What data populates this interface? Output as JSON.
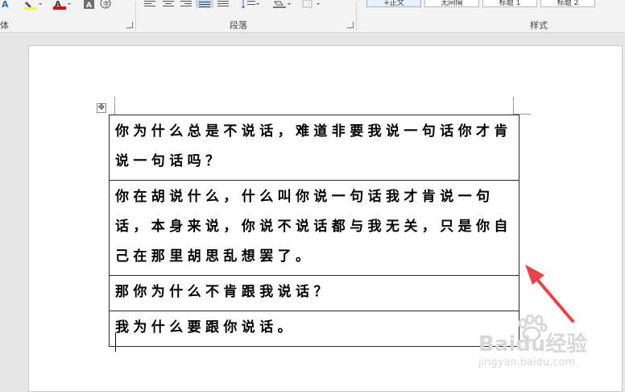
{
  "ribbon": {
    "font_group_label": "体",
    "paragraph_group_label": "段落",
    "styles_group_label": "样式",
    "styles": [
      "+正文",
      "无间隔",
      "标题 1",
      "标题 2"
    ]
  },
  "document": {
    "table_rows": [
      "你为什么总是不说话，难道非要我说一句话你才肯说一句话吗？",
      "你在胡说什么，什么叫你说一句话我才肯说一句话，本身来说，你说不说话都与我无关，只是你自己在那里胡思乱想罢了。",
      "那你为什么不肯跟我说话？",
      "我为什么要跟你说话。"
    ]
  },
  "annotation": {
    "arrow_color": "#e8434a"
  },
  "watermark": {
    "brand": "Baidu经验",
    "url": "jingyan.baidu.com"
  }
}
